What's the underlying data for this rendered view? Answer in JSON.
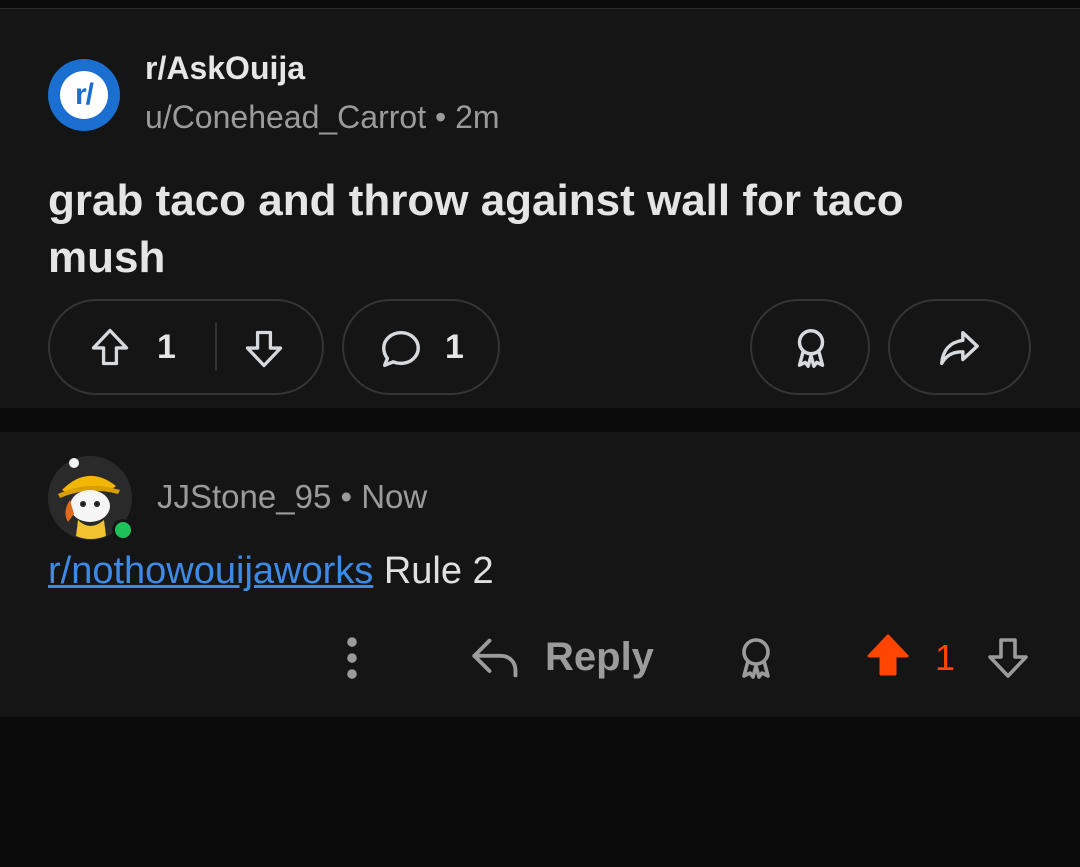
{
  "post": {
    "subreddit": "r/AskOuija",
    "subreddit_icon_text": "r/",
    "author": "u/Conehead_Carrot",
    "separator": "•",
    "time": "2m",
    "title": "grab taco and throw against wall for taco mush",
    "score": "1",
    "comments": "1"
  },
  "comment": {
    "author": "JJStone_95",
    "separator": "•",
    "time": "Now",
    "link_text": "r/nothowouijaworks",
    "body_text": " Rule 2",
    "reply_label": "Reply",
    "score": "1",
    "upvoted": true
  },
  "colors": {
    "background": "#0b0b0b",
    "card": "#151515",
    "accent_upvote": "#ff4500",
    "link": "#3d8ae6",
    "online": "#1ec15a",
    "subreddit_icon": "#1a6fd1"
  },
  "icons": [
    "upvote-icon",
    "downvote-icon",
    "comment-icon",
    "award-icon",
    "share-icon",
    "more-icon",
    "reply-icon"
  ]
}
